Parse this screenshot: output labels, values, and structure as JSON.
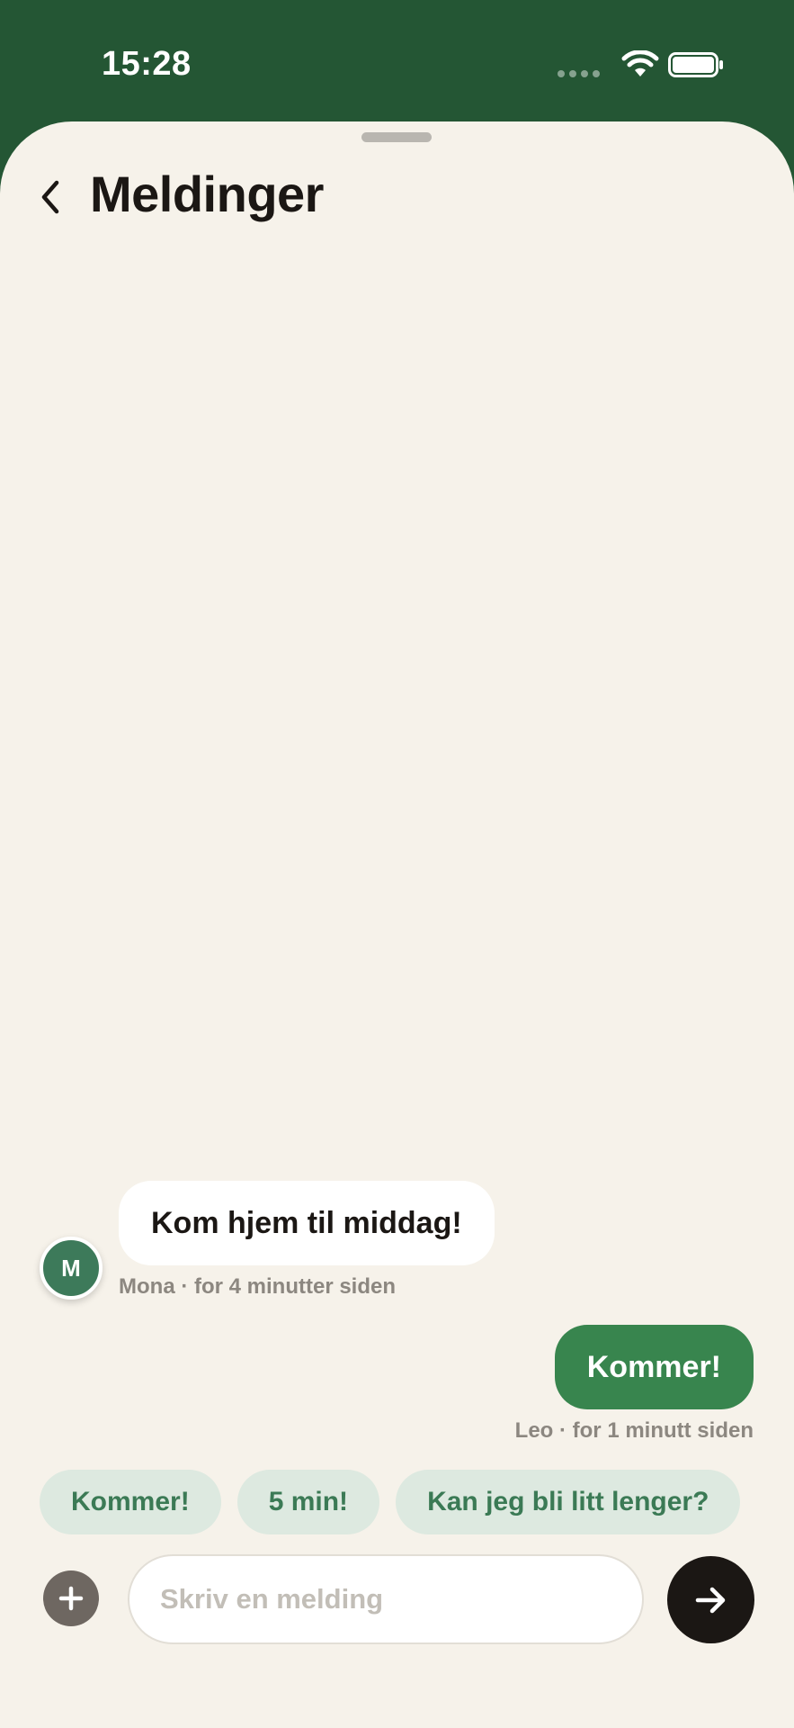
{
  "status_bar": {
    "time": "15:28",
    "icons": [
      "signal-dots-icon",
      "wifi-icon",
      "battery-icon"
    ]
  },
  "header": {
    "title": "Meldinger",
    "back_icon": "chevron-left-icon"
  },
  "messages": [
    {
      "direction": "incoming",
      "text": "Kom hjem til middag!",
      "avatar_initial": "M",
      "meta": "Mona · for 4 minutter siden"
    },
    {
      "direction": "outgoing",
      "text": "Kommer!",
      "meta": "Leo · for 1 minutt siden"
    }
  ],
  "quick_replies": [
    "Kommer!",
    "5 min!",
    "Kan jeg bli litt lenger?"
  ],
  "composer": {
    "placeholder": "Skriv en melding",
    "value": "",
    "add_icon": "plus-icon",
    "send_icon": "arrow-right-icon"
  },
  "colors": {
    "status_bar_bg": "#245634",
    "sheet_bg": "#f6f2ea",
    "outgoing_bubble": "#38854e",
    "chip_bg": "#dde9e0",
    "chip_text": "#3b7a55",
    "send_button": "#1b1714",
    "avatar": "#3d7a5a"
  }
}
